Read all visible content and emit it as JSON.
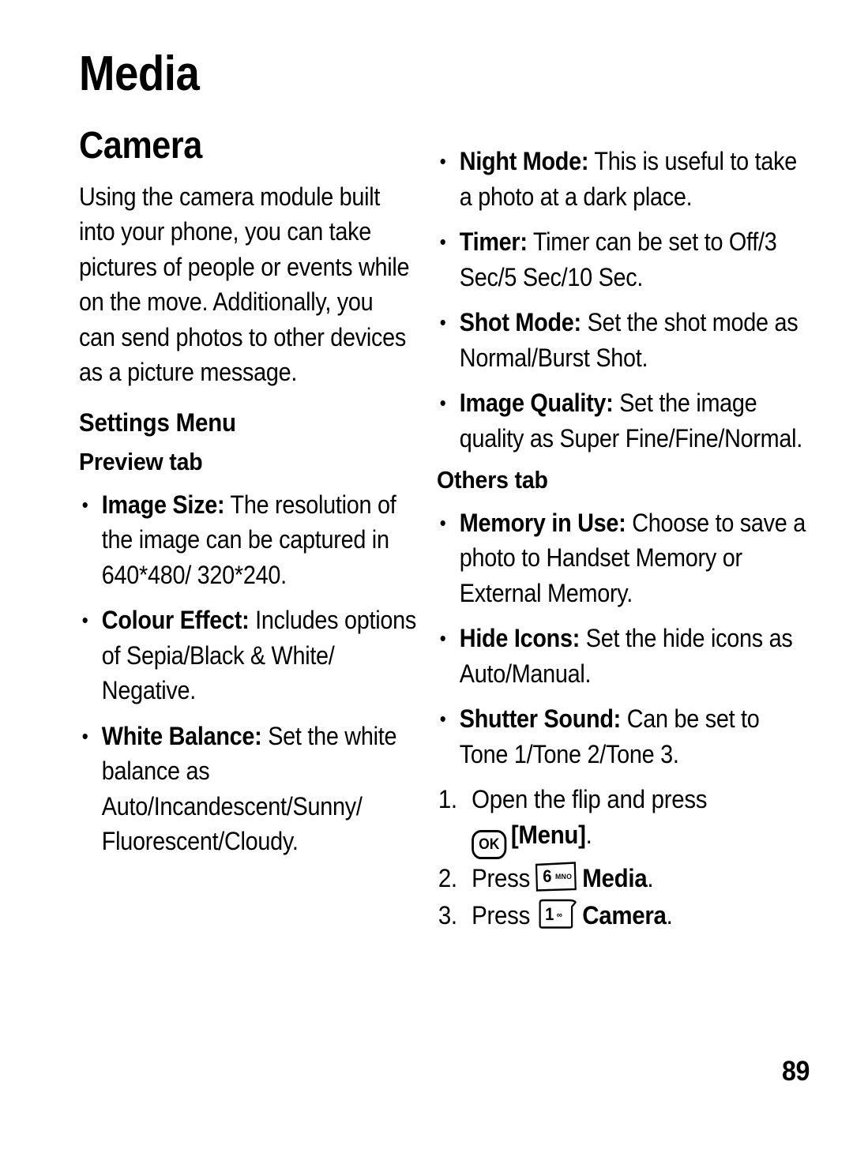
{
  "page": {
    "chapter_title": "Media",
    "page_number": "89"
  },
  "left_column": {
    "section_heading": "Camera",
    "intro_paragraph": "Using the camera module built into your phone, you can take pictures of people or events while on the move. Additionally, you can send photos to other devices as a picture message.",
    "settings_heading": "Settings Menu",
    "preview_tab_heading": "Preview tab",
    "preview_bullets": [
      {
        "term": "Image Size:",
        "text": " The resolution of the image can be captured in 640*480/ 320*240."
      },
      {
        "term": "Colour Effect:",
        "text": " Includes options of Sepia/Black & White/ Negative."
      },
      {
        "term": "White Balance:",
        "text": " Set the white balance as Auto/Incandescent/Sunny/ Fluorescent/Cloudy."
      }
    ]
  },
  "right_column": {
    "preview_bullets_continued": [
      {
        "term": "Night Mode:",
        "text": " This is useful to take a photo at a dark place."
      },
      {
        "term": "Timer:",
        "text": " Timer can be set to Off/3 Sec/5 Sec/10 Sec."
      },
      {
        "term": "Shot Mode:",
        "text": " Set the shot mode as Normal/Burst Shot."
      },
      {
        "term": "Image Quality:",
        "text": " Set the image quality as Super Fine/Fine/Normal."
      }
    ],
    "others_tab_heading": "Others tab",
    "others_bullets": [
      {
        "term": "Memory in Use:",
        "text": " Choose to save a photo to Handset Memory or External Memory."
      },
      {
        "term": "Hide Icons:",
        "text": " Set the hide icons as Auto/Manual."
      },
      {
        "term": "Shutter Sound:",
        "text": " Can be set to Tone 1/Tone 2/Tone 3."
      }
    ],
    "steps": [
      {
        "number": "1.",
        "text_before": "Open the flip and press",
        "key_icon": "ok-key-icon",
        "key_label": "OK",
        "text_after": "[Menu]",
        "trailing": "."
      },
      {
        "number": "2.",
        "text_before": "Press",
        "key_icon": "number-key-6-icon",
        "key_digit": "6",
        "key_letters": "MNO",
        "text_after": "Media",
        "trailing": "."
      },
      {
        "number": "3.",
        "text_before": "Press",
        "key_icon": "number-key-1-icon",
        "key_digit": "1",
        "key_letters": "∞",
        "text_after": "Camera",
        "trailing": "."
      }
    ]
  }
}
